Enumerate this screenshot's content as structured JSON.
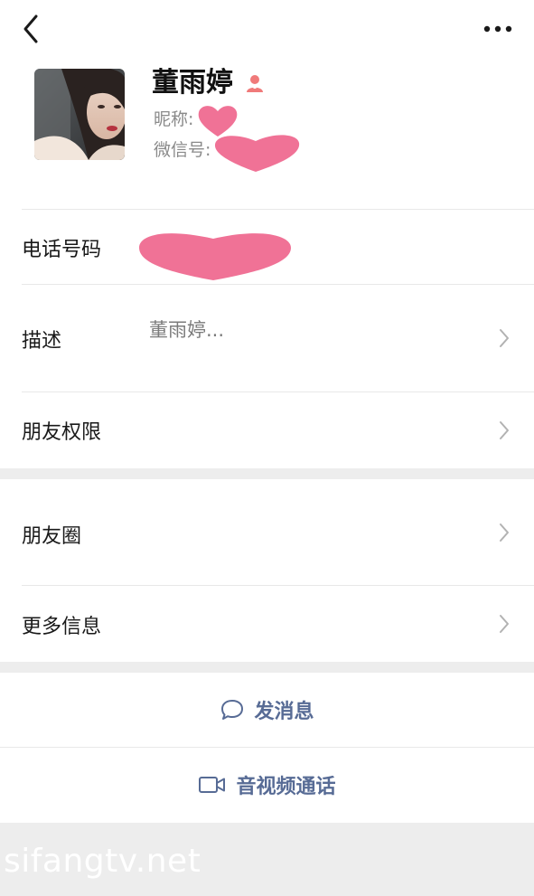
{
  "header": {
    "back_icon": "chevron-left-icon",
    "more_icon": "more-dots-icon"
  },
  "profile": {
    "name": "董雨婷",
    "gender_icon": "female-user-icon",
    "nickname_label": "昵称:",
    "wechat_id_label": "微信号:",
    "mask_color": "#f07296"
  },
  "rows": {
    "phone": {
      "label": "电话号码"
    },
    "description": {
      "label": "描述",
      "value": "董雨婷..."
    },
    "permissions": {
      "label": "朋友权限"
    },
    "moments": {
      "label": "朋友圈"
    },
    "more_info": {
      "label": "更多信息"
    }
  },
  "actions": {
    "message": {
      "label": "发消息",
      "icon": "chat-bubble-icon"
    },
    "call": {
      "label": "音视频通话",
      "icon": "video-call-icon"
    }
  },
  "watermark": "sifangtv.net",
  "colors": {
    "link_blue": "#576b95",
    "background": "#ededed",
    "heart_pink": "#f07296"
  }
}
